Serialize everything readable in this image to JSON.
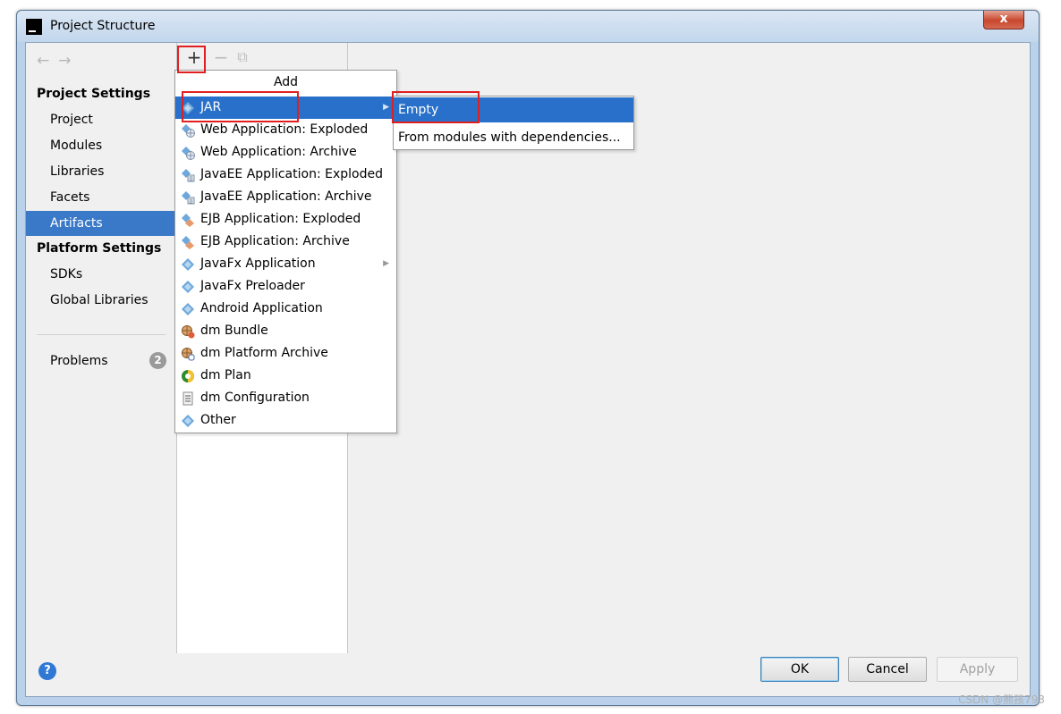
{
  "window": {
    "title": "Project Structure",
    "close_glyph": "x",
    "app_icon_text": "IJ"
  },
  "nav": {
    "back_glyph": "←",
    "forward_glyph": "→"
  },
  "sidebar": {
    "project_settings_title": "Project Settings",
    "project_items": [
      "Project",
      "Modules",
      "Libraries",
      "Facets",
      "Artifacts"
    ],
    "selected_item": "Artifacts",
    "platform_settings_title": "Platform Settings",
    "platform_items": [
      "SDKs",
      "Global Libraries"
    ],
    "problems_label": "Problems",
    "problems_count": "2"
  },
  "toolbar": {
    "add_glyph": "+",
    "remove_glyph": "−",
    "copy_glyph": "⧉"
  },
  "add_menu": {
    "header": "Add",
    "items": [
      {
        "label": "JAR",
        "icon": "jar-icon",
        "has_submenu": true,
        "highlighted": true
      },
      {
        "label": "Web Application: Exploded",
        "icon": "web-app-icon"
      },
      {
        "label": "Web Application: Archive",
        "icon": "web-app-icon"
      },
      {
        "label": "JavaEE Application: Exploded",
        "icon": "javaee-app-icon"
      },
      {
        "label": "JavaEE Application: Archive",
        "icon": "javaee-app-icon"
      },
      {
        "label": "EJB Application: Exploded",
        "icon": "ejb-app-icon"
      },
      {
        "label": "EJB Application: Archive",
        "icon": "ejb-app-icon"
      },
      {
        "label": "JavaFx Application",
        "icon": "javafx-icon",
        "has_submenu": true
      },
      {
        "label": "JavaFx Preloader",
        "icon": "javafx-icon"
      },
      {
        "label": "Android Application",
        "icon": "android-icon"
      },
      {
        "label": "dm Bundle",
        "icon": "dm-bundle-icon"
      },
      {
        "label": "dm Platform Archive",
        "icon": "dm-platform-icon"
      },
      {
        "label": "dm Plan",
        "icon": "dm-plan-icon"
      },
      {
        "label": "dm Configuration",
        "icon": "dm-config-icon"
      },
      {
        "label": "Other",
        "icon": "other-icon"
      }
    ]
  },
  "jar_submenu": {
    "items": [
      {
        "label": "Empty",
        "highlighted": true
      },
      {
        "label": "From modules with dependencies..."
      }
    ]
  },
  "buttons": {
    "help_glyph": "?",
    "ok": "OK",
    "cancel": "Cancel",
    "apply": "Apply"
  },
  "watermark": "CSDN @熊孩793",
  "colors": {
    "selection": "#3a78c8",
    "menu_highlight": "#2870c9",
    "annotation": "#e02020"
  }
}
